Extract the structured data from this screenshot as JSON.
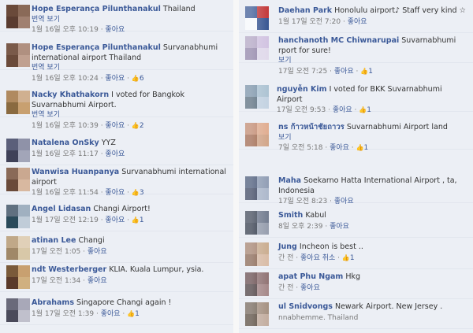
{
  "left_comments": [
    {
      "name": "Hope Esperança Pilunthanakul",
      "text": "Thailand",
      "translate": "번역 보기",
      "time": "1월 16일 오후 10:19",
      "like": "좋아요",
      "likes": ""
    },
    {
      "name": "Hope Esperança Pilunthanakul",
      "text": "Survanabhumi international airport Thailand",
      "translate": "번역 보기",
      "time": "1월 16일 오후 10:24",
      "like": "좋아요",
      "likes": "6"
    },
    {
      "name": "Nacky Khathakorn",
      "text": "I voted for Bangkok Suvarnabhumi Airport.",
      "translate": "번역 보기",
      "time": "1월 16일 오후 10:39",
      "like": "좋아요",
      "likes": "2"
    },
    {
      "name": "Natalena OnSky",
      "text": "YYZ",
      "translate": "",
      "time": "1월 16일 오후 11:17",
      "like": "좋아요",
      "likes": ""
    },
    {
      "name": "Wanwisa Huanpanya",
      "text": "Survanabhumi international airport",
      "translate": "",
      "time": "1월 16일 오후 11:54",
      "like": "좋아요",
      "likes": "3"
    },
    {
      "name": "Angel Lidasan",
      "text": "Changi Airport!",
      "translate": "",
      "time": "1월 17일 오전 12:19",
      "like": "좋아요",
      "likes": "1"
    },
    {
      "name": "atinan Lee",
      "text": "Changi",
      "translate": "",
      "time": "17일 오전 1:05",
      "like": "좋아요",
      "likes": ""
    },
    {
      "name": "ndt Westerberger",
      "text": "KLIA. Kuala Lumpur, ysia.",
      "translate": "",
      "time": "17일 오전 1:34",
      "like": "좋아요",
      "likes": ""
    },
    {
      "name": "Abrahams",
      "text": "Singapore Changi again !",
      "translate": "",
      "time": "1월 17일 오전 1:39",
      "like": "좋아요",
      "likes": "1"
    }
  ],
  "right_comments": [
    {
      "name": "Daehan Park",
      "text": "Honolulu airport♪ Staff very kind ☆",
      "translate": "",
      "time": "1월 17일 오전 7:20",
      "like": "좋아요",
      "likes": ""
    },
    {
      "name": "hanchanoth MC Chiwnarupai",
      "text": "Suvarnabhumi rport for sure!",
      "translate": "보기",
      "time": "17일 오전 7:25",
      "like": "좋아요",
      "likes": "1"
    },
    {
      "name": "nguyễn Kim",
      "text": "I voted for BKK Suvarnabhumi Airport",
      "translate": "",
      "time": "17일 오전 9:53",
      "like": "좋아요",
      "likes": "1"
    },
    {
      "name": "ns ก้าวหน้าชัยถาวร",
      "text": "Suvarnabhumi Airport land",
      "translate": "보기",
      "time": "7일 오전 5:18",
      "like": "좋아요",
      "likes": "1"
    },
    {
      "name": "Maha",
      "text": "Soekarno Hatta International Airport , ta, Indonesia",
      "translate": "",
      "time": "17일 오전 8:23",
      "like": "좋아요",
      "likes": ""
    },
    {
      "name": "Smith",
      "text": "Kabul",
      "translate": "",
      "time": "8일 오후 2:39",
      "like": "좋아요",
      "likes": ""
    },
    {
      "name": "Jung",
      "text": "Incheon is best ..",
      "translate": "",
      "time": "간 전",
      "like": "좋아요 취소",
      "likes": "1"
    },
    {
      "name": "apat Phu Ngam",
      "text": "Hkg",
      "translate": "",
      "time": "간 전",
      "like": "좋아요",
      "likes": ""
    },
    {
      "name": "ul Snidvongs",
      "text": "Newark Airport. New Jersey .",
      "translate": "",
      "time": "nnabhemme. Thailand",
      "like": "",
      "likes": ""
    }
  ],
  "colors": {
    "link": "#3b5998",
    "bg": "#eceff5",
    "meta": "#777777"
  },
  "icons": {
    "like": "thumbs-up-icon",
    "avatar": "profile-avatar"
  }
}
